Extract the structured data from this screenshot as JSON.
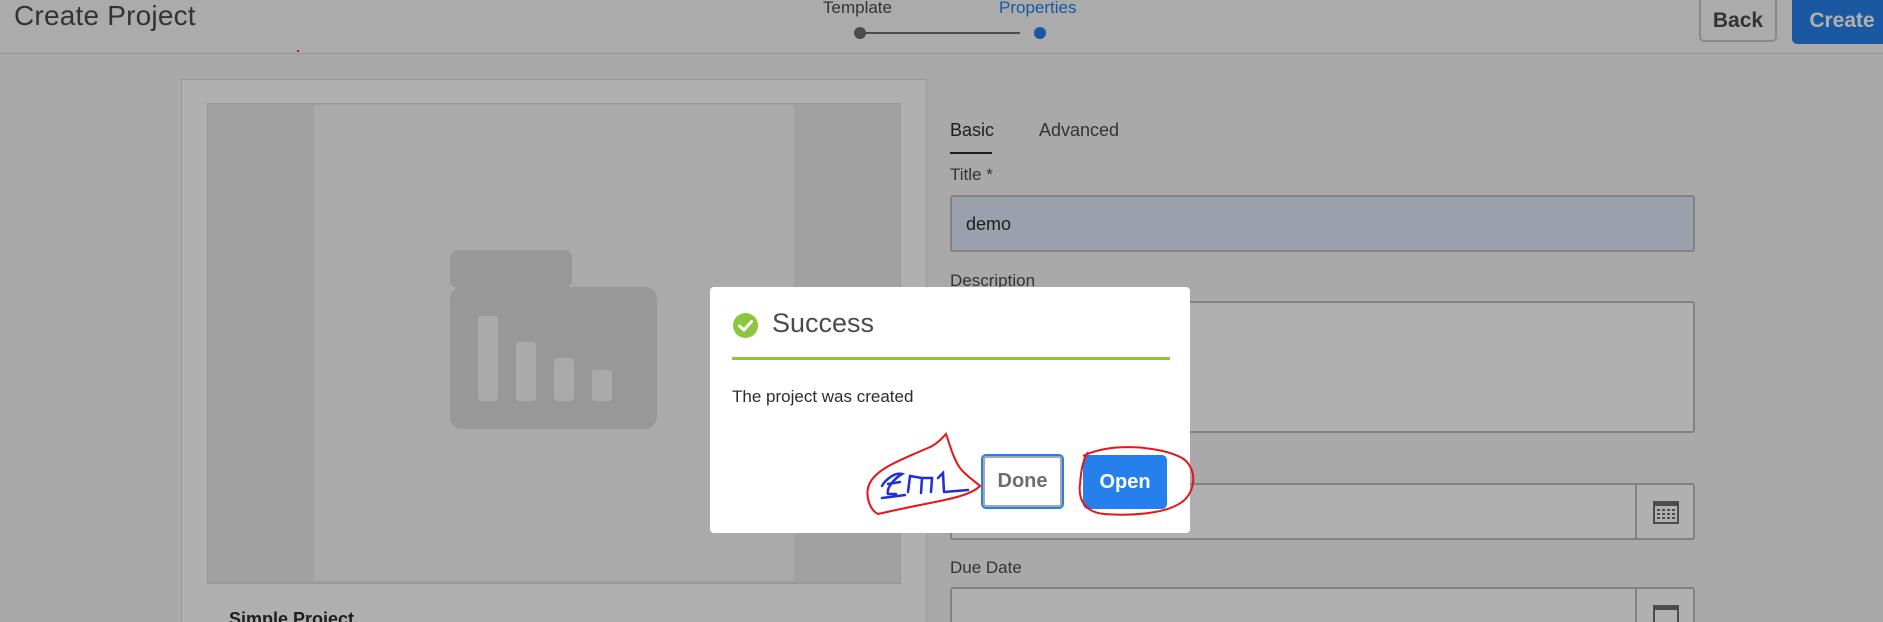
{
  "header": {
    "title": "Create Project",
    "steps": [
      {
        "label": "Template",
        "state": "done"
      },
      {
        "label": "Properties",
        "state": "current"
      }
    ],
    "back_label": "Back",
    "create_label": "Create"
  },
  "template_card": {
    "name": "Simple Project",
    "thumbnail_icon": "folder-chart-icon"
  },
  "form": {
    "tabs": [
      {
        "label": "Basic",
        "active": true
      },
      {
        "label": "Advanced",
        "active": false
      }
    ],
    "title_label": "Title *",
    "title_value": "demo",
    "description_label": "Description",
    "description_value": "",
    "start_date_value": "",
    "due_date_label": "Due Date",
    "due_date_value": "",
    "calendar_icon": "calendar-icon"
  },
  "dialog": {
    "status_icon": "check-circle-icon",
    "title": "Success",
    "message": "The project was created",
    "done_label": "Done",
    "open_label": "Open"
  },
  "colors": {
    "accent": "#2680eb",
    "success": "#8ec53e",
    "annotation_red": "#e8141a",
    "annotation_blue": "#1f2ed6"
  }
}
